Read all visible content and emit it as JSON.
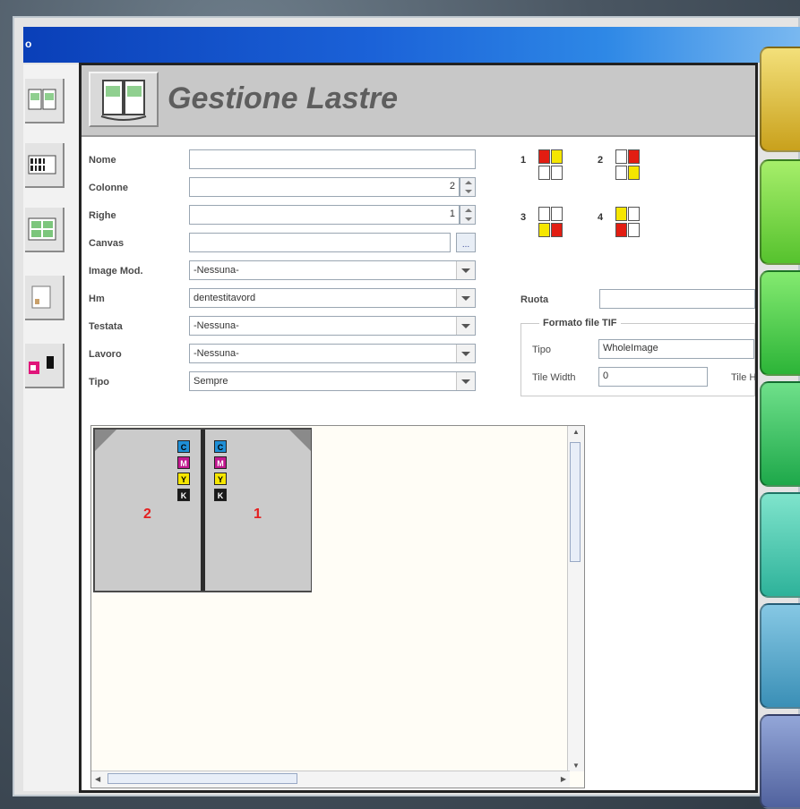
{
  "window": {
    "title_fragment": "o"
  },
  "panel": {
    "title": "Gestione Lastre"
  },
  "form": {
    "nome": {
      "label": "Nome",
      "value": ""
    },
    "colonne": {
      "label": "Colonne",
      "value": "2"
    },
    "righe": {
      "label": "Righe",
      "value": "1"
    },
    "canvas": {
      "label": "Canvas",
      "value": "",
      "browse": "..."
    },
    "image_mod": {
      "label": "Image Mod.",
      "value": "-Nessuna-"
    },
    "hm": {
      "label": "Hm",
      "value": "dentestitavord"
    },
    "testata": {
      "label": "Testata",
      "value": "-Nessuna-"
    },
    "lavoro": {
      "label": "Lavoro",
      "value": "-Nessuna-"
    },
    "tipo": {
      "label": "Tipo",
      "value": "Sempre"
    }
  },
  "right": {
    "ruota": {
      "label": "Ruota",
      "value": ""
    },
    "group_title": "Formato file TIF",
    "tipo": {
      "label": "Tipo",
      "value": "WholeImage"
    },
    "tile_width": {
      "label": "Tile Width",
      "value": "0"
    },
    "tile_h": {
      "label": "Tile H"
    }
  },
  "layouts": [
    {
      "num": "1"
    },
    {
      "num": "2"
    },
    {
      "num": "3"
    },
    {
      "num": "4"
    }
  ],
  "preview": {
    "plate_left_num": "2",
    "plate_right_num": "1",
    "inks": [
      "C",
      "M",
      "Y",
      "K"
    ]
  },
  "colors": {
    "ink_c": "#1f8fd6",
    "ink_m": "#c2188f",
    "ink_y": "#f5e600",
    "ink_k": "#1a1a1a",
    "red": "#e21d12",
    "yellow": "#f5e600"
  }
}
